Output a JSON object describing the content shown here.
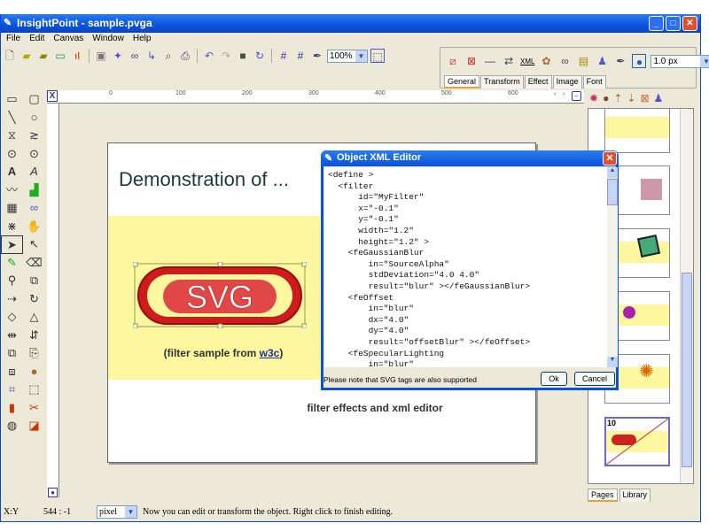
{
  "window": {
    "title": "InsightPoint - sample.pvga",
    "controls": [
      "minimize",
      "maximize",
      "close"
    ]
  },
  "menu": [
    "File",
    "Edit",
    "Canvas",
    "Window",
    "Help"
  ],
  "toolbar": {
    "zoom": "100%",
    "icons": [
      "new-icon",
      "open-icon",
      "open-folder-icon",
      "image-icon",
      "chart-icon",
      "save-icon",
      "effect-icon",
      "glasses-icon",
      "export-icon",
      "preview-icon",
      "print-icon",
      "undo-icon",
      "redo-icon",
      "bag-icon",
      "refresh-icon",
      "grid-icon",
      "grid-snap-icon",
      "pen-icon",
      "select-frame-icon"
    ]
  },
  "props": {
    "stroke_width": "1.0 px",
    "xml_label": "XML",
    "tabs": [
      "General",
      "Transform",
      "Effect",
      "Image",
      "Font"
    ],
    "active_tab": "General"
  },
  "ruler": {
    "ticks": [
      "0",
      "100",
      "200",
      "300",
      "400",
      "500",
      "600"
    ]
  },
  "page": {
    "title": "Demonstration of ...",
    "logo_text": "SVG",
    "caption_prefix": "(filter sample from ",
    "caption_link": "w3c",
    "caption_suffix": ")",
    "subtitle": "filter effects and xml editor"
  },
  "dialog": {
    "title": "Object XML Editor",
    "code": "<define >\n  <filter\n      id=\"MyFilter\"\n      x=\"-0.1\"\n      y=\"-0.1\"\n      width=\"1.2\"\n      height=\"1.2\" >\n    <feGaussianBlur\n        in=\"SourceAlpha\"\n        stdDeviation=\"4.0 4.0\"\n        result=\"blur\" ></feGaussianBlur>\n    <feOffset\n        in=\"blur\"\n        dx=\"4.0\"\n        dy=\"4.0\"\n        result=\"offsetBlur\" ></feOffset>\n    <feSpecularLighting\n        in=\"blur\"",
    "note": "Please note that SVG tags are also supported",
    "ok": "Ok",
    "cancel": "Cancel"
  },
  "pages_panel": {
    "tabs": [
      "Pages",
      "Library"
    ],
    "active_tab": "Pages",
    "selected_page_number": "10"
  },
  "status": {
    "coord_label": "X:Y",
    "coord_value": "544 : -1",
    "unit": "pixel",
    "message": "Now you can edit or transform the object. Right click to finish editing."
  }
}
